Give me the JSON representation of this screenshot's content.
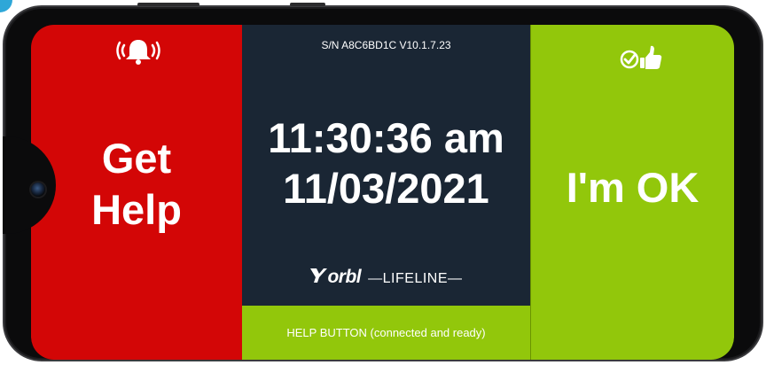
{
  "device": {
    "serial_text": "S/N A8C6BD1C V10.1.7.23"
  },
  "help_panel": {
    "icon": "alarm-bell-icon",
    "label_line1": "Get",
    "label_line2": "Help",
    "color": "#d30606"
  },
  "center_panel": {
    "time": "11:30:36 am",
    "date": "11/03/2021",
    "brand_logo": "orbl",
    "brand_tagline": "—LIFELINE—",
    "status_text": "HELP BUTTON (connected and ready)",
    "background": "#1a2634",
    "status_color": "#92c70b"
  },
  "ok_panel": {
    "icon": "check-thumbs-up-icon",
    "label": "I'm OK",
    "color": "#92c70b"
  }
}
